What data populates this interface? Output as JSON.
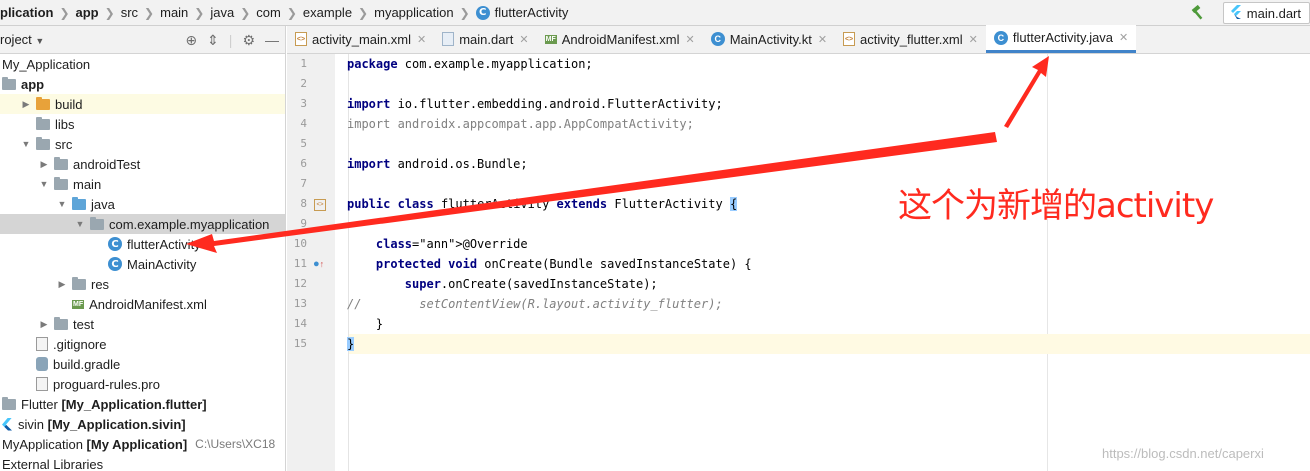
{
  "breadcrumbs": [
    "plication",
    "app",
    "src",
    "main",
    "java",
    "com",
    "example",
    "myapplication",
    "flutterActivity"
  ],
  "run_config": "main.dart",
  "project": {
    "header": "roject",
    "tree": [
      {
        "label": "My_Application",
        "indent": 0,
        "icon": "none",
        "arrow": ""
      },
      {
        "label": "app",
        "indent": 0,
        "icon": "module",
        "arrow": "",
        "bold": true
      },
      {
        "label": "build",
        "indent": 1,
        "icon": "folder-orange",
        "arrow": "right"
      },
      {
        "label": "libs",
        "indent": 1,
        "icon": "folder-gray",
        "arrow": ""
      },
      {
        "label": "src",
        "indent": 1,
        "icon": "folder-gray",
        "arrow": "down"
      },
      {
        "label": "androidTest",
        "indent": 2,
        "icon": "folder-gray",
        "arrow": "right"
      },
      {
        "label": "main",
        "indent": 2,
        "icon": "folder-gray",
        "arrow": "down"
      },
      {
        "label": "java",
        "indent": 3,
        "icon": "folder-blue",
        "arrow": "down"
      },
      {
        "label": "com.example.myapplication",
        "indent": 4,
        "icon": "package",
        "arrow": "down"
      },
      {
        "label": "flutterActivity",
        "indent": 5,
        "icon": "class",
        "arrow": ""
      },
      {
        "label": "MainActivity",
        "indent": 5,
        "icon": "class-kt",
        "arrow": ""
      },
      {
        "label": "res",
        "indent": 3,
        "icon": "folder-gray",
        "arrow": "right"
      },
      {
        "label": "AndroidManifest.xml",
        "indent": 3,
        "icon": "manifest",
        "arrow": ""
      },
      {
        "label": "test",
        "indent": 2,
        "icon": "folder-gray",
        "arrow": "right"
      },
      {
        "label": ".gitignore",
        "indent": 1,
        "icon": "file",
        "arrow": ""
      },
      {
        "label": "build.gradle",
        "indent": 1,
        "icon": "gradle",
        "arrow": ""
      },
      {
        "label": "proguard-rules.pro",
        "indent": 1,
        "icon": "file",
        "arrow": ""
      },
      {
        "label": "Flutter [My_Application.flutter]",
        "indent": 0,
        "icon": "module",
        "arrow": ""
      },
      {
        "label": "sivin [My_Application.sivin]",
        "indent": 0,
        "icon": "flutter",
        "arrow": ""
      },
      {
        "label": "MyApplication [My Application]",
        "indent": 0,
        "icon": "none",
        "arrow": "",
        "path": "C:\\Users\\XC18"
      },
      {
        "label": "External Libraries",
        "indent": 0,
        "icon": "none",
        "arrow": ""
      }
    ]
  },
  "tabs": [
    {
      "label": "activity_main.xml",
      "icon": "xml",
      "active": false
    },
    {
      "label": "main.dart",
      "icon": "dart",
      "active": false
    },
    {
      "label": "AndroidManifest.xml",
      "icon": "manifest",
      "active": false
    },
    {
      "label": "MainActivity.kt",
      "icon": "kotlin",
      "active": false
    },
    {
      "label": "activity_flutter.xml",
      "icon": "xml",
      "active": false
    },
    {
      "label": "flutterActivity.java",
      "icon": "java",
      "active": true
    }
  ],
  "code": {
    "line_numbers": [
      "1",
      "2",
      "3",
      "4",
      "5",
      "6",
      "7",
      "8",
      "9",
      "10",
      "11",
      "12",
      "13",
      "14",
      "15"
    ],
    "lines": [
      "package com.example.myapplication;",
      "",
      "import io.flutter.embedding.android.FlutterActivity;",
      "import androidx.appcompat.app.AppCompatActivity;",
      "",
      "import android.os.Bundle;",
      "",
      "public class flutterActivity extends FlutterActivity {",
      "",
      "    @Override",
      "    protected void onCreate(Bundle savedInstanceState) {",
      "        super.onCreate(savedInstanceState);",
      "//        setContentView(R.layout.activity_flutter);",
      "    }",
      "}"
    ]
  },
  "annotation": {
    "text": "这个为新增的activity",
    "color": "#ff2a1f"
  },
  "watermark": "https://blog.csdn.net/caperxi",
  "colors": {
    "keyword": "#000080",
    "annotation": "#808000",
    "comment": "#808080",
    "selection": "#d5d5d5",
    "tab_underline": "#4083c9",
    "arrow": "#ff2a1f"
  }
}
